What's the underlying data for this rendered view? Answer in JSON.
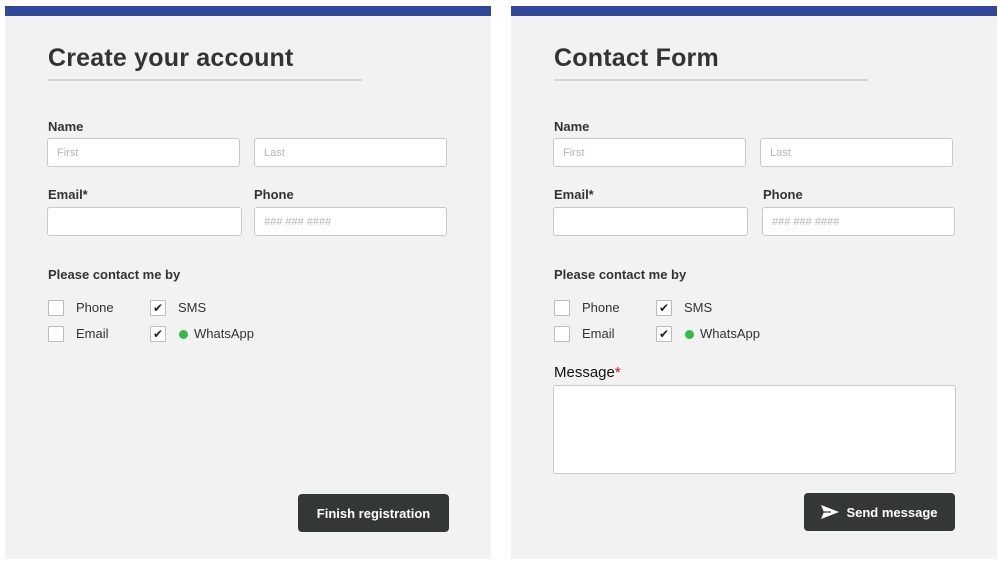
{
  "left_form": {
    "title": "Create your account",
    "name_label": "Name",
    "first_placeholder": "First",
    "last_placeholder": "Last",
    "email_label": "Email*",
    "phone_label": "Phone",
    "phone_placeholder": "### ### ####",
    "contact_label": "Please contact me by",
    "options": [
      {
        "label": "Phone",
        "checked": false
      },
      {
        "label": "SMS",
        "checked": true
      },
      {
        "label": "Email",
        "checked": false
      },
      {
        "label": "WhatsApp",
        "checked": true,
        "icon": "whatsapp-icon"
      }
    ],
    "button_label": "Finish registration"
  },
  "right_form": {
    "title": "Contact Form",
    "name_label": "Name",
    "first_placeholder": "First",
    "last_placeholder": "Last",
    "email_label": "Email*",
    "phone_label": "Phone",
    "phone_placeholder": "### ### ####",
    "contact_label": "Please contact me by",
    "options": [
      {
        "label": "Phone",
        "checked": false
      },
      {
        "label": "SMS",
        "checked": true
      },
      {
        "label": "Email",
        "checked": false
      },
      {
        "label": "WhatsApp",
        "checked": true,
        "icon": "whatsapp-icon"
      }
    ],
    "message_label": "Message",
    "message_required_mark": "*",
    "button_label": "Send message",
    "button_icon": "send-icon"
  },
  "colors": {
    "accent_bar": "#33479a",
    "panel_bg": "#f2f2f2",
    "button_bg": "#343738",
    "whatsapp_green": "#34b84a",
    "required_red": "#c8102e"
  }
}
